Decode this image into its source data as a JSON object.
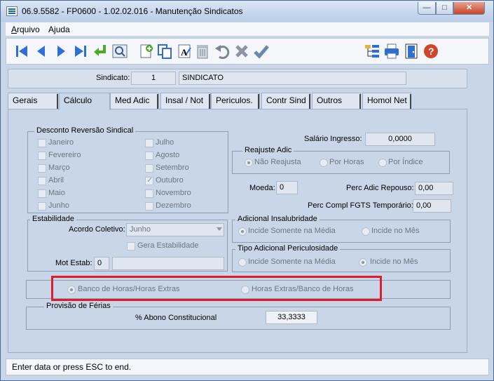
{
  "window": {
    "title": "06.9.5582 - FP0600 - 1.02.02.016 - Manutenção Sindicatos",
    "min_glyph": "—",
    "max_glyph": "□",
    "close_glyph": "✕"
  },
  "menu": {
    "items": [
      {
        "label": "Arquivo"
      },
      {
        "label": "Ajuda"
      }
    ]
  },
  "toolbar": {
    "icons": [
      "first-record-icon",
      "previous-record-icon",
      "next-record-icon",
      "last-record-icon",
      "goto-icon",
      "search-icon",
      "new-record-icon",
      "copy-icon",
      "edit-icon",
      "delete-icon",
      "undo-icon",
      "cancel-icon",
      "save-icon",
      "tree-icon",
      "print-icon",
      "exit-door-icon",
      "help-icon"
    ]
  },
  "sindicato": {
    "label": "Sindicato:",
    "code": "1",
    "name": "SINDICATO"
  },
  "tabs": [
    {
      "label": "Gerais",
      "active": false
    },
    {
      "label": "Cálculo",
      "active": true
    },
    {
      "label": "Med Adic",
      "active": false
    },
    {
      "label": "Insal / Not",
      "active": false
    },
    {
      "label": "Periculos.",
      "active": false
    },
    {
      "label": "Contr Sind",
      "active": false
    },
    {
      "label": "Outros",
      "active": false
    },
    {
      "label": "Homol Net",
      "active": false
    }
  ],
  "desconto": {
    "title": "Desconto Reversão Sindical",
    "months_left": [
      {
        "label": "Janeiro",
        "checked": false
      },
      {
        "label": "Fevereiro",
        "checked": false
      },
      {
        "label": "Março",
        "checked": false
      },
      {
        "label": "Abril",
        "checked": false
      },
      {
        "label": "Maio",
        "checked": false
      },
      {
        "label": "Junho",
        "checked": false
      }
    ],
    "months_right": [
      {
        "label": "Julho",
        "checked": false
      },
      {
        "label": "Agosto",
        "checked": false
      },
      {
        "label": "Setembro",
        "checked": false
      },
      {
        "label": "Outubro",
        "checked": true
      },
      {
        "label": "Novembro",
        "checked": false
      },
      {
        "label": "Dezembro",
        "checked": false
      }
    ]
  },
  "salario": {
    "label": "Salário Ingresso:",
    "value": "0,0000"
  },
  "reajuste": {
    "title": "Reajuste Adic",
    "options": [
      {
        "label": "Não Reajusta",
        "selected": true
      },
      {
        "label": "Por Horas",
        "selected": false
      },
      {
        "label": "Por Índice",
        "selected": false
      }
    ]
  },
  "moeda": {
    "label": "Moeda:",
    "value": "0"
  },
  "perc_repouso": {
    "label": "Perc Adic Repouso:",
    "value": "0,00"
  },
  "perc_fgts": {
    "label": "Perc Compl FGTS Temporário:",
    "value": "0,00"
  },
  "estabilidade": {
    "title": "Estabilidade",
    "acordo_label": "Acordo Coletivo:",
    "acordo_value": "Junho",
    "gera_label": "Gera Estabilidade",
    "mot_label": "Mot Estab:",
    "mot_value": "0",
    "mot_desc": ""
  },
  "insalubridade": {
    "title": "Adicional Insalubridade",
    "options": [
      {
        "label": "Incide Somente na Média",
        "selected": true
      },
      {
        "label": "Incide no Mês",
        "selected": false
      }
    ]
  },
  "periculosidade": {
    "title": "Tipo Adicional Periculosidade",
    "options": [
      {
        "label": "Incide Somente na Média",
        "selected": false
      },
      {
        "label": "Incide no Mês",
        "selected": true
      }
    ]
  },
  "banco": {
    "options": [
      {
        "label": "Banco de Horas/Horas Extras",
        "selected": true
      },
      {
        "label": "Horas Extras/Banco de Horas",
        "selected": false
      }
    ]
  },
  "ferias": {
    "title": "Provisão de Férias",
    "abono_label": "% Abono Constitucional",
    "abono_value": "33,3333"
  },
  "status": {
    "text": "Enter data or press ESC to end."
  },
  "colors": {
    "highlight": "#e01b2a",
    "background": "#c9d6e7"
  }
}
